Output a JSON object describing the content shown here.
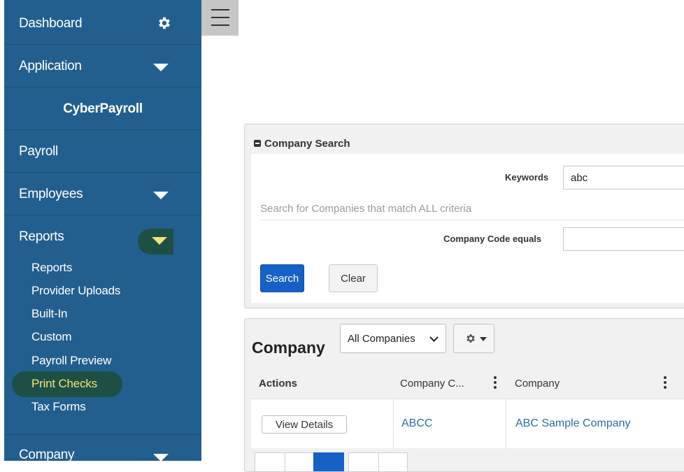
{
  "sidebar": {
    "dashboard_label": "Dashboard",
    "application_label": "Application",
    "app_name": "CyberPayroll",
    "payroll_label": "Payroll",
    "employees_label": "Employees",
    "reports_label": "Reports",
    "reports_submenu": [
      "Reports",
      "Provider Uploads",
      "Built-In",
      "Custom",
      "Payroll Preview",
      "Print Checks",
      "Tax Forms"
    ],
    "active_submenu": "Print Checks",
    "company_label": "Company",
    "highlight_color": "#f3e27a",
    "bg_color": "#235f8e"
  },
  "search_panel": {
    "title": "Company Search",
    "keywords_label": "Keywords",
    "keywords_value": "abc",
    "hint": "Search for Companies that match ALL criteria",
    "company_code_label": "Company Code equals",
    "company_code_value": "",
    "search_button": "Search",
    "clear_button": "Clear"
  },
  "grid": {
    "title": "Company",
    "filter_selected": "All Companies",
    "columns": [
      "Actions",
      "Company C...",
      "Company"
    ],
    "rows": [
      {
        "action": "View Details",
        "code": "ABCC",
        "company": "ABC Sample Company"
      }
    ]
  }
}
